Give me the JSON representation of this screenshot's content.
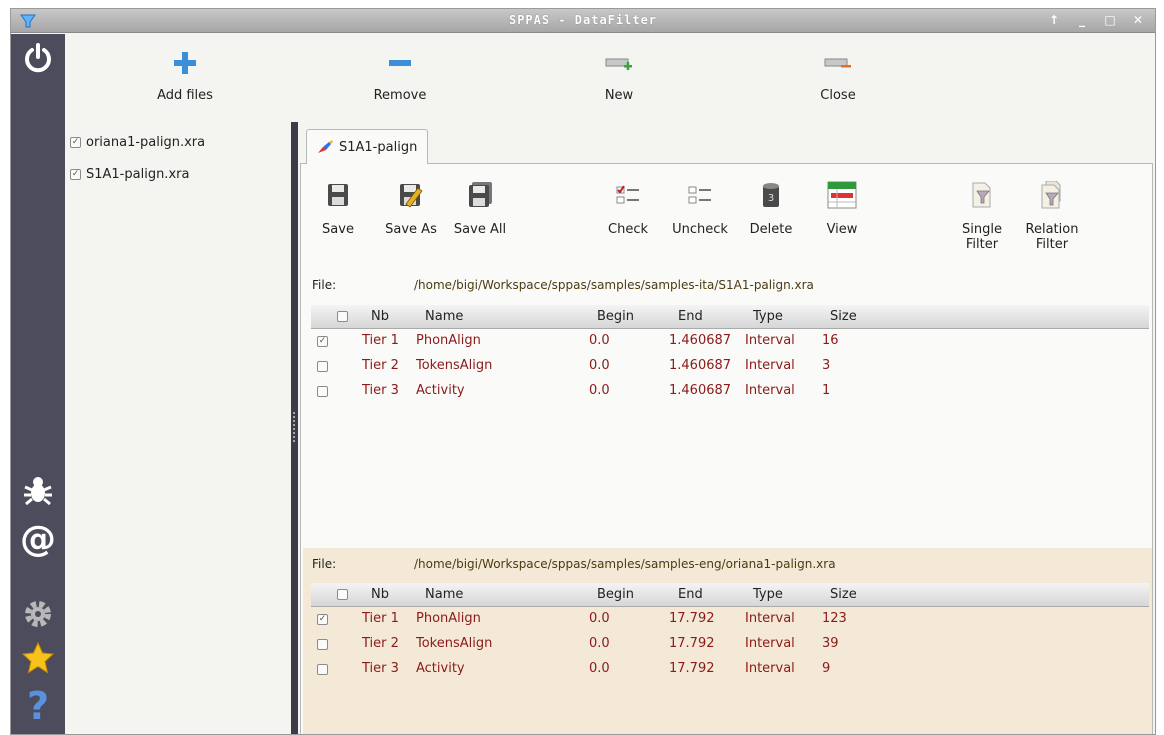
{
  "window": {
    "title": "SPPAS - DataFilter",
    "buttons": [
      "↑",
      "_",
      "□",
      "✕"
    ]
  },
  "sidebar": {
    "icons": [
      "power-icon",
      "bug-icon",
      "at-icon",
      "gear-icon",
      "star-icon",
      "help-icon"
    ]
  },
  "toolbar": {
    "add_files": "Add files",
    "remove": "Remove",
    "new": "New",
    "close": "Close"
  },
  "filelist": [
    {
      "name": "oriana1-palign.xra",
      "checked": true
    },
    {
      "name": "S1A1-palign.xra",
      "checked": true
    }
  ],
  "tab": {
    "label": "S1A1-palign"
  },
  "page_tools": {
    "save": "Save",
    "save_as": "Save As",
    "save_all": "Save All",
    "check": "Check",
    "uncheck": "Uncheck",
    "delete": "Delete",
    "view": "View",
    "single_filter": "Single\nFilter",
    "relation_filter": "Relation\nFilter"
  },
  "panel1": {
    "file_label": "File:",
    "path": "/home/bigi/Workspace/sppas/samples/samples-ita/S1A1-palign.xra",
    "columns": [
      "Nb",
      "Name",
      "Begin",
      "End",
      "Type",
      "Size"
    ],
    "rows": [
      {
        "checked": true,
        "nb": "Tier 1",
        "name": "PhonAlign",
        "begin": "0.0",
        "end": "1.460687",
        "type": "Interval",
        "size": "16"
      },
      {
        "checked": false,
        "nb": "Tier 2",
        "name": "TokensAlign",
        "begin": "0.0",
        "end": "1.460687",
        "type": "Interval",
        "size": "3"
      },
      {
        "checked": false,
        "nb": "Tier 3",
        "name": "Activity",
        "begin": "0.0",
        "end": "1.460687",
        "type": "Interval",
        "size": "1"
      }
    ]
  },
  "panel2": {
    "file_label": "File:",
    "path": "/home/bigi/Workspace/sppas/samples/samples-eng/oriana1-palign.xra",
    "columns": [
      "Nb",
      "Name",
      "Begin",
      "End",
      "Type",
      "Size"
    ],
    "rows": [
      {
        "checked": true,
        "nb": "Tier 1",
        "name": "PhonAlign",
        "begin": "0.0",
        "end": "17.792",
        "type": "Interval",
        "size": "123"
      },
      {
        "checked": false,
        "nb": "Tier 2",
        "name": "TokensAlign",
        "begin": "0.0",
        "end": "17.792",
        "type": "Interval",
        "size": "39"
      },
      {
        "checked": false,
        "nb": "Tier 3",
        "name": "Activity",
        "begin": "0.0",
        "end": "17.792",
        "type": "Interval",
        "size": "9"
      }
    ]
  }
}
